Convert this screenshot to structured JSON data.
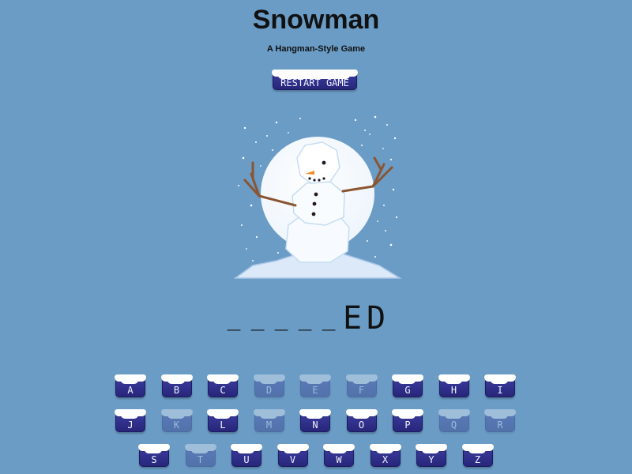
{
  "title": "Snowman",
  "subtitle": "A Hangman-Style Game",
  "restart_label": "RESTART GAME",
  "word_slots": [
    "_",
    "_",
    "_",
    "_",
    "_",
    "E",
    "D"
  ],
  "keyboard": {
    "row1": [
      {
        "letter": "A",
        "used": false
      },
      {
        "letter": "B",
        "used": false
      },
      {
        "letter": "C",
        "used": false
      },
      {
        "letter": "D",
        "used": true
      },
      {
        "letter": "E",
        "used": true
      },
      {
        "letter": "F",
        "used": true
      },
      {
        "letter": "G",
        "used": false
      },
      {
        "letter": "H",
        "used": false
      },
      {
        "letter": "I",
        "used": false
      }
    ],
    "row2": [
      {
        "letter": "J",
        "used": false
      },
      {
        "letter": "K",
        "used": true
      },
      {
        "letter": "L",
        "used": false
      },
      {
        "letter": "M",
        "used": true
      },
      {
        "letter": "N",
        "used": false
      },
      {
        "letter": "O",
        "used": false
      },
      {
        "letter": "P",
        "used": false
      },
      {
        "letter": "Q",
        "used": true
      },
      {
        "letter": "R",
        "used": true
      }
    ],
    "row3": [
      {
        "letter": "S",
        "used": false
      },
      {
        "letter": "T",
        "used": true
      },
      {
        "letter": "U",
        "used": false
      },
      {
        "letter": "V",
        "used": false
      },
      {
        "letter": "W",
        "used": false
      },
      {
        "letter": "X",
        "used": false
      },
      {
        "letter": "Y",
        "used": false
      },
      {
        "letter": "Z",
        "used": false
      }
    ]
  },
  "colors": {
    "background": "#6a9cc6",
    "button": "#2f2f8c",
    "snow": "#ffffff"
  }
}
